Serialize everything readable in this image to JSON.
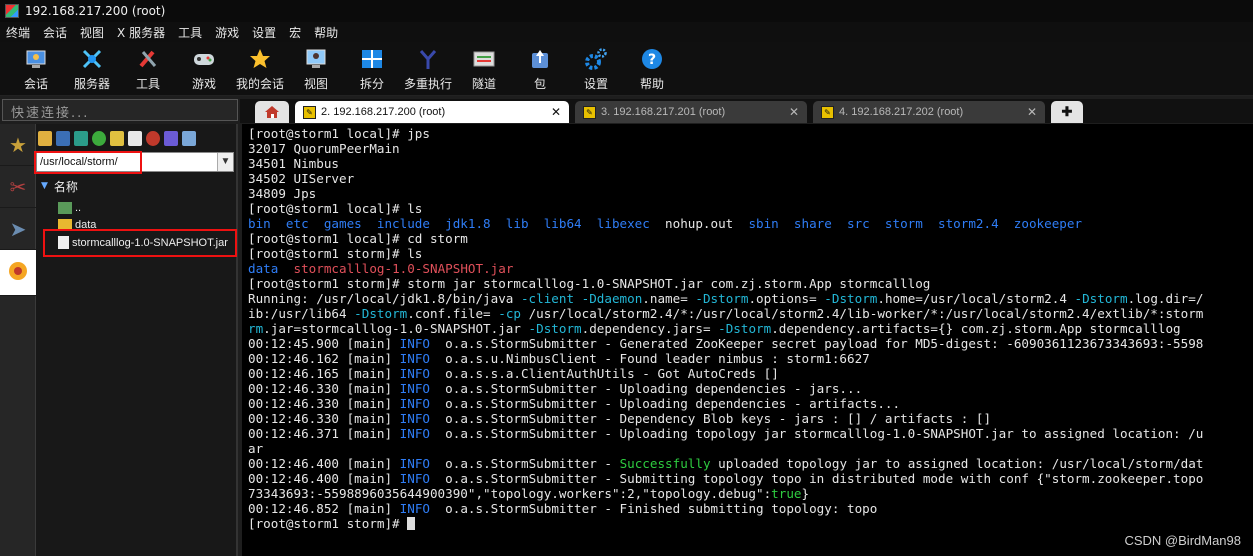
{
  "window": {
    "title": "192.168.217.200 (root)"
  },
  "menu": [
    "终端",
    "会话",
    "视图",
    "X 服务器",
    "工具",
    "游戏",
    "设置",
    "宏",
    "帮助"
  ],
  "toolbar": [
    {
      "label": "会话",
      "icon": "session-icon"
    },
    {
      "label": "服务器",
      "icon": "servers-icon"
    },
    {
      "label": "工具",
      "icon": "tools-icon"
    },
    {
      "label": "游戏",
      "icon": "games-icon"
    },
    {
      "label": "我的会话",
      "icon": "star-icon"
    },
    {
      "label": "视图",
      "icon": "view-icon"
    },
    {
      "label": "拆分",
      "icon": "split-icon"
    },
    {
      "label": "多重执行",
      "icon": "multiexec-icon"
    },
    {
      "label": "隧道",
      "icon": "tunnel-icon"
    },
    {
      "label": "包",
      "icon": "packages-icon"
    },
    {
      "label": "设置",
      "icon": "gear-icon"
    },
    {
      "label": "帮助",
      "icon": "help-icon"
    }
  ],
  "quick_connect": {
    "placeholder": "快速连接..."
  },
  "sftp": {
    "path": "/usr/local/storm/",
    "column_header": "名称",
    "items": [
      "..",
      "data",
      "stormcalllog-1.0-SNAPSHOT.jar"
    ]
  },
  "tabs": [
    {
      "label": "2. 192.168.217.200 (root)",
      "active": true
    },
    {
      "label": "3. 192.168.217.201 (root)",
      "active": false
    },
    {
      "label": "4. 192.168.217.202 (root)",
      "active": false
    }
  ],
  "colors": {
    "blue": "#2f7df6",
    "red": "#e0505a",
    "green": "#2ecc40",
    "cyan": "#23b7d6",
    "highlight": "#ee1111"
  },
  "terminal": {
    "lines": [
      [
        {
          "t": "[root@storm1 local]# jps"
        }
      ],
      [
        {
          "t": "32017 QuorumPeerMain"
        }
      ],
      [
        {
          "t": "34501 Nimbus"
        }
      ],
      [
        {
          "t": "34502 UIServer"
        }
      ],
      [
        {
          "t": "34809 Jps"
        }
      ],
      [
        {
          "t": "[root@storm1 local]# ls"
        }
      ],
      [
        {
          "t": "bin  etc  games  include  jdk1.8  lib  lib64  libexec",
          "c": "blue"
        },
        {
          "t": "  nohup.out  "
        },
        {
          "t": "sbin  share  src  storm  storm2.4  zookeeper",
          "c": "blue"
        }
      ],
      [
        {
          "t": "[root@storm1 local]# cd storm"
        }
      ],
      [
        {
          "t": "[root@storm1 storm]# ls"
        }
      ],
      [
        {
          "t": "data",
          "c": "blue"
        },
        {
          "t": "  "
        },
        {
          "t": "stormcalllog-1.0-SNAPSHOT.jar",
          "c": "red"
        }
      ],
      [
        {
          "t": "[root@storm1 storm]# storm jar stormcalllog-1.0-SNAPSHOT.jar com.zj.storm.App stormcalllog"
        }
      ],
      [
        {
          "t": "Running: /usr/local/jdk1.8/bin/java "
        },
        {
          "t": "-client -Ddaemon",
          "c": "cyan"
        },
        {
          "t": ".name= "
        },
        {
          "t": "-Dstorm",
          "c": "cyan"
        },
        {
          "t": ".options= "
        },
        {
          "t": "-Dstorm",
          "c": "cyan"
        },
        {
          "t": ".home=/usr/local/storm2.4 "
        },
        {
          "t": "-Dstorm",
          "c": "cyan"
        },
        {
          "t": ".log.dir=/"
        }
      ],
      [
        {
          "t": "ib:/usr/lib64 "
        },
        {
          "t": "-Dstorm",
          "c": "cyan"
        },
        {
          "t": ".conf.file= "
        },
        {
          "t": "-cp",
          "c": "cyan"
        },
        {
          "t": " /usr/local/storm2.4/*:/usr/local/storm2.4/lib-worker/*:/usr/local/storm2.4/extlib/*:storm"
        }
      ],
      [
        {
          "t": "rm",
          "c": "cyan"
        },
        {
          "t": ".jar=stormcalllog-1.0-SNAPSHOT.jar "
        },
        {
          "t": "-Dstorm",
          "c": "cyan"
        },
        {
          "t": ".dependency.jars= "
        },
        {
          "t": "-Dstorm",
          "c": "cyan"
        },
        {
          "t": ".dependency.artifacts={} com.zj.storm.App stormcalllog"
        }
      ],
      [
        {
          "t": "00:12:45.900 [main] "
        },
        {
          "t": "INFO",
          "c": "blue"
        },
        {
          "t": "  o.a.s.StormSubmitter - Generated ZooKeeper secret payload for MD5-digest: -6090361123673343693:-5598"
        }
      ],
      [
        {
          "t": "00:12:46.162 [main] "
        },
        {
          "t": "INFO",
          "c": "blue"
        },
        {
          "t": "  o.a.s.u.NimbusClient - Found leader nimbus : storm1:6627"
        }
      ],
      [
        {
          "t": "00:12:46.165 [main] "
        },
        {
          "t": "INFO",
          "c": "blue"
        },
        {
          "t": "  o.a.s.s.a.ClientAuthUtils - Got AutoCreds []"
        }
      ],
      [
        {
          "t": "00:12:46.330 [main] "
        },
        {
          "t": "INFO",
          "c": "blue"
        },
        {
          "t": "  o.a.s.StormSubmitter - Uploading dependencies - jars..."
        }
      ],
      [
        {
          "t": "00:12:46.330 [main] "
        },
        {
          "t": "INFO",
          "c": "blue"
        },
        {
          "t": "  o.a.s.StormSubmitter - Uploading dependencies - artifacts..."
        }
      ],
      [
        {
          "t": "00:12:46.330 [main] "
        },
        {
          "t": "INFO",
          "c": "blue"
        },
        {
          "t": "  o.a.s.StormSubmitter - Dependency Blob keys - jars : [] / artifacts : []"
        }
      ],
      [
        {
          "t": "00:12:46.371 [main] "
        },
        {
          "t": "INFO",
          "c": "blue"
        },
        {
          "t": "  o.a.s.StormSubmitter - Uploading topology jar stormcalllog-1.0-SNAPSHOT.jar to assigned location: /u"
        }
      ],
      [
        {
          "t": "ar"
        }
      ],
      [
        {
          "t": "00:12:46.400 [main] "
        },
        {
          "t": "INFO",
          "c": "blue"
        },
        {
          "t": "  o.a.s.StormSubmitter - "
        },
        {
          "t": "Successfully",
          "c": "green"
        },
        {
          "t": " uploaded topology jar to assigned location: /usr/local/storm/dat"
        }
      ],
      [
        {
          "t": "00:12:46.400 [main] "
        },
        {
          "t": "INFO",
          "c": "blue"
        },
        {
          "t": "  o.a.s.StormSubmitter - Submitting topology topo in distributed mode with conf {\"storm.zookeeper.topo"
        }
      ],
      [
        {
          "t": "73343693:-5598896035644900390\",\"topology.workers\":2,\"topology.debug\":"
        },
        {
          "t": "true",
          "c": "green"
        },
        {
          "t": "}"
        }
      ],
      [
        {
          "t": "00:12:46.852 [main] "
        },
        {
          "t": "INFO",
          "c": "blue"
        },
        {
          "t": "  o.a.s.StormSubmitter - Finished submitting topology: topo"
        }
      ],
      [
        {
          "t": "[root@storm1 storm]# "
        },
        {
          "cursor": true
        }
      ]
    ]
  },
  "watermark": "CSDN @BirdMan98"
}
